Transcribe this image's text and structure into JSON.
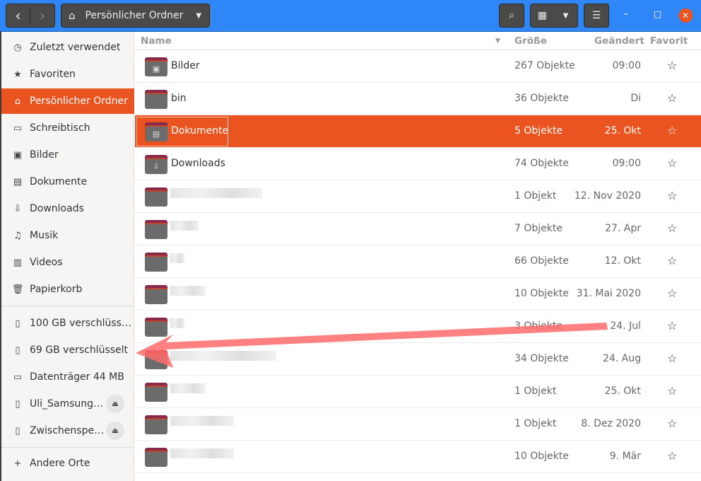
{
  "header": {
    "path_label": "Persönlicher Ordner",
    "back": "‹",
    "forward": "›"
  },
  "columns": {
    "name": "Name",
    "size": "Größe",
    "modified": "Geändert",
    "favorite": "Favorit"
  },
  "sidebar": {
    "items": [
      {
        "label": "Zuletzt verwendet",
        "icon": "clock-icon"
      },
      {
        "label": "Favoriten",
        "icon": "star-icon"
      },
      {
        "label": "Persönlicher Ordner",
        "icon": "home-icon",
        "active": true
      },
      {
        "label": "Schreibtisch",
        "icon": "desktop-icon"
      },
      {
        "label": "Bilder",
        "icon": "image-icon"
      },
      {
        "label": "Dokumente",
        "icon": "document-icon"
      },
      {
        "label": "Downloads",
        "icon": "download-icon"
      },
      {
        "label": "Musik",
        "icon": "music-icon"
      },
      {
        "label": "Videos",
        "icon": "video-icon"
      },
      {
        "label": "Papierkorb",
        "icon": "trash-icon"
      }
    ],
    "devices": [
      {
        "label": "100 GB verschlüss…"
      },
      {
        "label": "69 GB verschlüsselt"
      },
      {
        "label": "Datenträger 44 MB"
      },
      {
        "label": "Uli_Samsung…",
        "eject": true
      },
      {
        "label": "Zwischenspe…",
        "eject": true
      }
    ],
    "other": "Andere Orte"
  },
  "files": [
    {
      "name": "Bilder",
      "size": "267 Objekte",
      "modified": "09:00"
    },
    {
      "name": "bin",
      "size": "36 Objekte",
      "modified": "Di"
    },
    {
      "name": "Dokumente",
      "size": "5 Objekte",
      "modified": "25. Okt",
      "selected": true
    },
    {
      "name": "Downloads",
      "size": "74 Objekte",
      "modified": "09:00"
    },
    {
      "name": "",
      "size": "1 Objekt",
      "modified": "12. Nov 2020"
    },
    {
      "name": "",
      "size": "7 Objekte",
      "modified": "27. Apr"
    },
    {
      "name": "",
      "size": "66 Objekte",
      "modified": "12. Okt"
    },
    {
      "name": "",
      "size": "10 Objekte",
      "modified": "31. Mai 2020"
    },
    {
      "name": "",
      "size": "3 Objekte",
      "modified": "24. Jul"
    },
    {
      "name": "",
      "size": "34 Objekte",
      "modified": "24. Aug"
    },
    {
      "name": "",
      "size": "1 Objekt",
      "modified": "25. Okt"
    },
    {
      "name": "",
      "size": "1 Objekt",
      "modified": "8. Dez 2020"
    },
    {
      "name": "",
      "size": "10 Objekte",
      "modified": "9. Mär"
    }
  ],
  "annotation_color": "#ff6b6b",
  "accent": "#e95420"
}
